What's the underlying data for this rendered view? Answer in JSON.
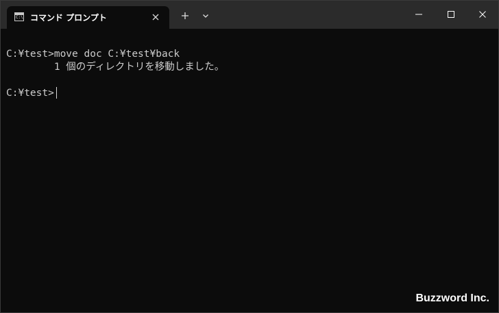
{
  "tab": {
    "title": "コマンド プロンプト",
    "icon_text": "C:\\"
  },
  "terminal": {
    "lines": [
      "C:¥test>move doc C:¥test¥back",
      "        1 個のディレクトリを移動しました。",
      "C:¥test>"
    ]
  },
  "watermark": "Buzzword Inc.",
  "icons": {
    "tab_close": "close-icon",
    "new_tab": "plus-icon",
    "dropdown": "chevron-down-icon",
    "minimize": "minimize-icon",
    "maximize": "maximize-icon",
    "close": "close-icon"
  },
  "colors": {
    "titlebar": "#2b2b2b",
    "terminal_bg": "#0c0c0c",
    "text": "#cccccc"
  }
}
